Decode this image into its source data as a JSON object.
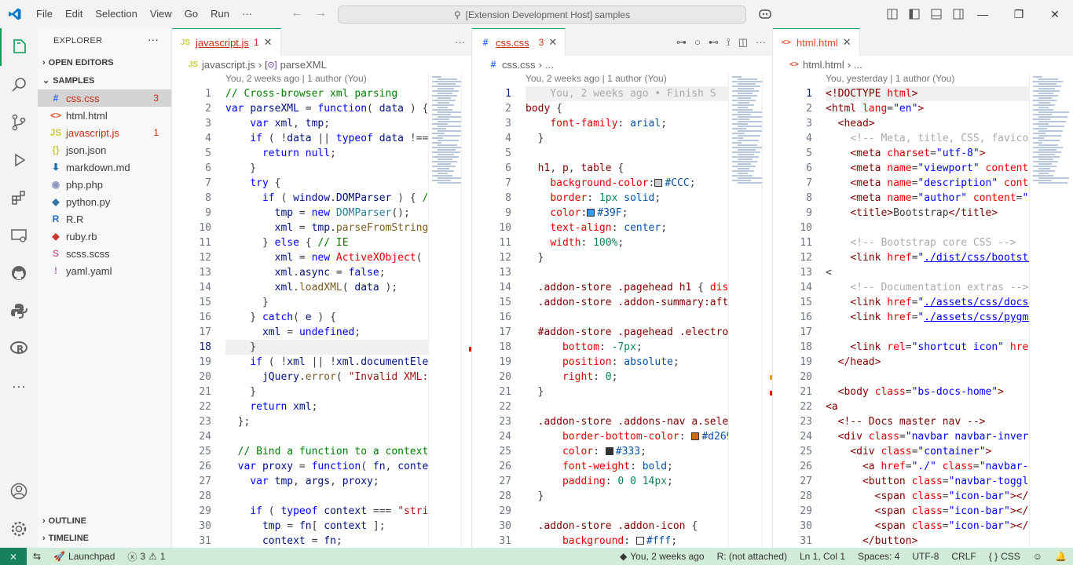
{
  "titlebar": {
    "menus": [
      "File",
      "Edit",
      "Selection",
      "View",
      "Go",
      "Run",
      "···"
    ],
    "search": "[Extension Development Host] samples"
  },
  "sidebar": {
    "title": "EXPLORER",
    "sections": {
      "open_editors": "OPEN EDITORS",
      "samples": "SAMPLES",
      "outline": "OUTLINE",
      "timeline": "TIMELINE"
    },
    "files": [
      {
        "name": "css.css",
        "icon": "#",
        "color": "#2965f1",
        "badge": "3",
        "err": true
      },
      {
        "name": "html.html",
        "icon": "<>",
        "color": "#e44d26",
        "badge": "",
        "err": false
      },
      {
        "name": "javascript.js",
        "icon": "JS",
        "color": "#cbcb41",
        "badge": "1",
        "err": true
      },
      {
        "name": "json.json",
        "icon": "{}",
        "color": "#cbcb41",
        "badge": "",
        "err": false
      },
      {
        "name": "markdown.md",
        "icon": "⬇",
        "color": "#1e6fa8",
        "badge": "",
        "err": false
      },
      {
        "name": "php.php",
        "icon": "◉",
        "color": "#8993be",
        "badge": "",
        "err": false
      },
      {
        "name": "python.py",
        "icon": "◆",
        "color": "#3572a5",
        "badge": "",
        "err": false
      },
      {
        "name": "R.R",
        "icon": "R",
        "color": "#276dc3",
        "badge": "",
        "err": false
      },
      {
        "name": "ruby.rb",
        "icon": "◆",
        "color": "#cc342d",
        "badge": "",
        "err": false
      },
      {
        "name": "scss.scss",
        "icon": "S",
        "color": "#cd6799",
        "badge": "",
        "err": false
      },
      {
        "name": "yaml.yaml",
        "icon": "!",
        "color": "#a074c4",
        "badge": "",
        "err": false
      }
    ]
  },
  "editors": {
    "js": {
      "tab": "javascript.js",
      "badge": "1",
      "crumb_file": "javascript.js",
      "crumb_sym": "parseXML",
      "blame": "You, 2 weeks ago | 1 author (You)",
      "current_line": 18
    },
    "css": {
      "tab": "css.css",
      "badge": "3",
      "crumb_file": "css.css",
      "crumb_sym": "...",
      "blame": "You, 2 weeks ago | 1 author (You)",
      "inline_blame": "You, 2 weeks ago • Finish S",
      "current_line": 1
    },
    "html": {
      "tab": "html.html",
      "badge": "",
      "crumb_file": "html.html",
      "crumb_sym": "...",
      "blame": "You, yesterday | 1 author (You)",
      "current_line": 1
    }
  },
  "statusbar": {
    "launchpad": "Launchpad",
    "errors": "3",
    "warnings": "1",
    "blame": "You, 2 weeks ago",
    "r_status": "R: (not attached)",
    "cursor": "Ln 1, Col 1",
    "spaces": "Spaces: 4",
    "encoding": "UTF-8",
    "eol": "CRLF",
    "language": "CSS"
  },
  "colors": {
    "accent": "#0f9d58",
    "status_bg": "#d1ebd9",
    "error": "#c72e0f"
  }
}
